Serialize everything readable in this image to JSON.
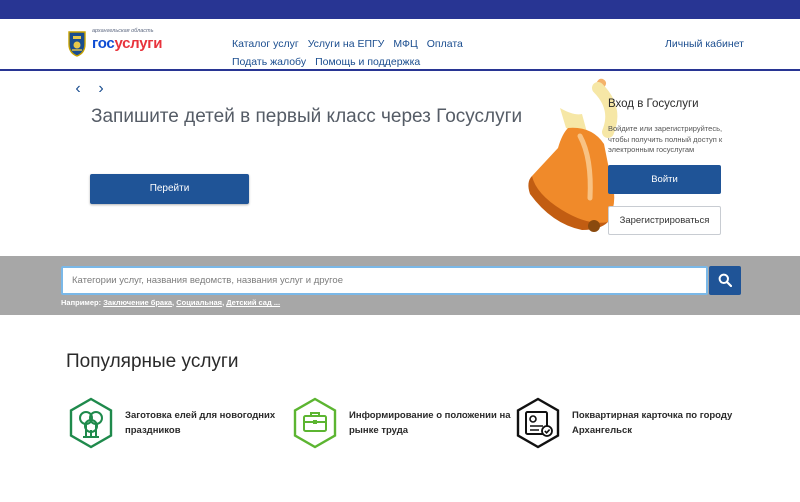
{
  "header": {
    "logo_region": "архангельская область",
    "logo_part1": "гос",
    "logo_part2": "услуги",
    "nav": [
      {
        "label": "Каталог услуг"
      },
      {
        "label": "Услуги на ЕПГУ"
      },
      {
        "label": "МФЦ"
      },
      {
        "label": "Оплата"
      },
      {
        "label": "Подать жалобу"
      },
      {
        "label": "Помощь и поддержка"
      }
    ],
    "cabinet_label": "Личный кабинет"
  },
  "promo": {
    "prev_icon": "chevron-left-icon",
    "next_icon": "chevron-right-icon",
    "title": "Запишите детей в первый класс через Госуслуги",
    "button_label": "Перейти"
  },
  "login": {
    "title": "Вход в Госуслуги",
    "description": "Войдите или зарегистрируйтесь, чтобы получить полный доступ к электронным госуслугам",
    "login_label": "Войти",
    "register_label": "Зарегистрироваться"
  },
  "search": {
    "placeholder": "Категории услуг, названия ведомств, названия услуг и другое",
    "value": "",
    "examples_prefix": "Например:",
    "examples": [
      "Заключение брака",
      "Социальная",
      "Детский сад ..."
    ]
  },
  "popular": {
    "title": "Популярные услуги",
    "items": [
      {
        "label": "Заготовка елей для новогодних праздников",
        "icon": "trees-icon",
        "color": "#1f8a4c"
      },
      {
        "label": "Информирование о положении на рынке труда",
        "icon": "briefcase-icon",
        "color": "#5cb531"
      },
      {
        "label": "Поквартирная карточка по городу Архангельск",
        "icon": "id-card-icon",
        "color": "#111111"
      }
    ]
  },
  "colors": {
    "top_bar": "#283593",
    "primary_button": "#1f5497",
    "link": "#1a4d8f",
    "bell": "#f08a2a"
  }
}
